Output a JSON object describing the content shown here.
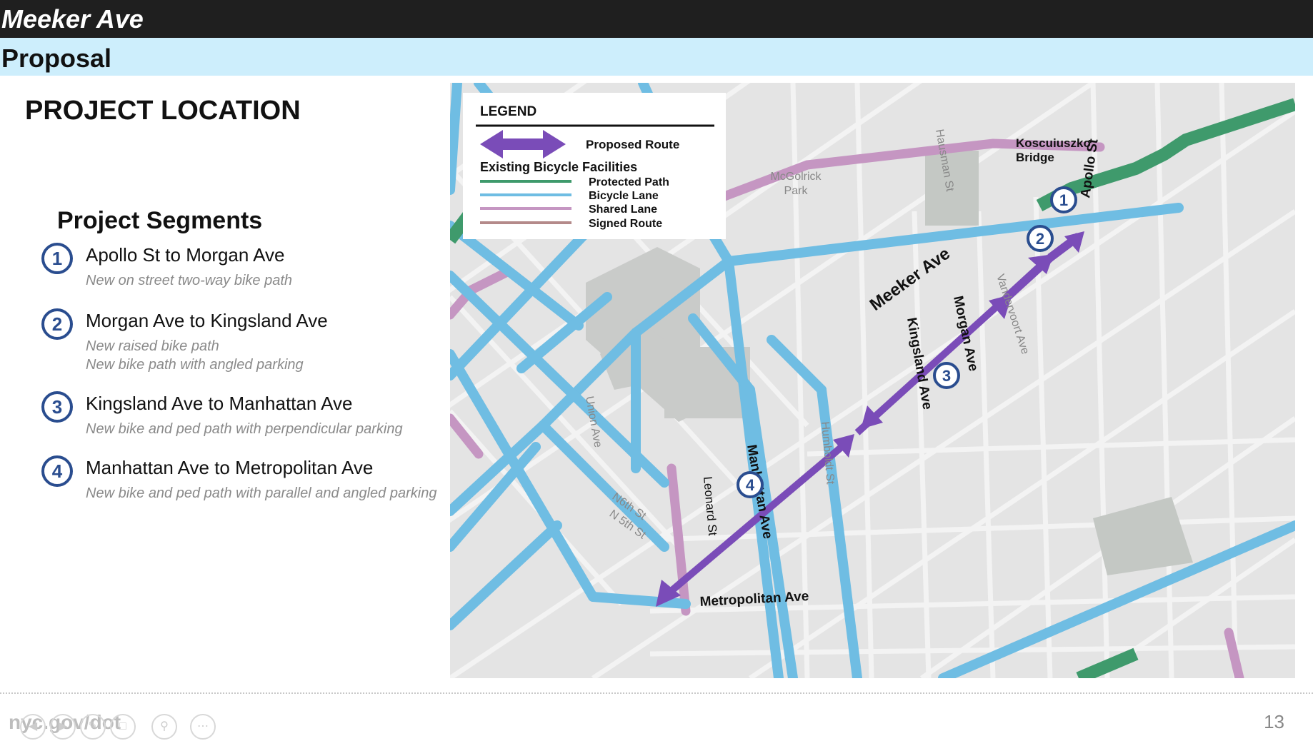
{
  "header": {
    "title": "Meeker Ave",
    "subtitle": "Proposal"
  },
  "content": {
    "heading": "PROJECT LOCATION",
    "segments_heading": "Project Segments",
    "segments": [
      {
        "num": "1",
        "title": "Apollo St to Morgan Ave",
        "desc": "New on street two-way bike path"
      },
      {
        "num": "2",
        "title": "Morgan Ave to Kingsland Ave",
        "desc1": "New raised bike path",
        "desc2": "New bike path with angled parking"
      },
      {
        "num": "3",
        "title": "Kingsland Ave to Manhattan Ave",
        "desc": "New bike and ped path with perpendicular parking"
      },
      {
        "num": "4",
        "title": "Manhattan Ave to Metropolitan Ave",
        "desc": "New bike and ped path with parallel and angled parking"
      }
    ]
  },
  "legend": {
    "title": "LEGEND",
    "proposed_route": "Proposed Route",
    "existing_label": "Existing Bicycle  Facilities",
    "protected_path": "Protected Path",
    "bicycle_lane": "Bicycle Lane",
    "shared_lane": "Shared Lane",
    "signed_route": "Signed Route"
  },
  "map": {
    "streets": {
      "meeker": "Meeker Ave",
      "apollo": "Apollo St",
      "hausman": "Hausman St",
      "morgan": "Morgan Ave",
      "vandervoort": "Vandervoort Ave",
      "kingsland": "Kingsland Ave",
      "humboldt": "Humboldt St",
      "manhattan": "Manhattan Ave",
      "leonard": "Leonard St",
      "union": "Union Ave",
      "metropolitan": "Metropolitan Ave",
      "n6": "N6th St",
      "n5": "N 5th St"
    },
    "places": {
      "park_line1": "McGolrick",
      "park_line2": "Park",
      "bridge_line1": "Koscuiuszko",
      "bridge_line2": "Bridge"
    },
    "markers": [
      "1",
      "2",
      "3",
      "4"
    ]
  },
  "colors": {
    "proposed": "#7a4cb8",
    "protected_path": "#3f9a6c",
    "bicycle_lane": "#6fbde3",
    "shared_lane": "#c596c2",
    "signed_route": "#b48a8a",
    "badge": "#2a4d8f"
  },
  "footer": {
    "site": "nyc.gov/dot",
    "page": "13"
  }
}
